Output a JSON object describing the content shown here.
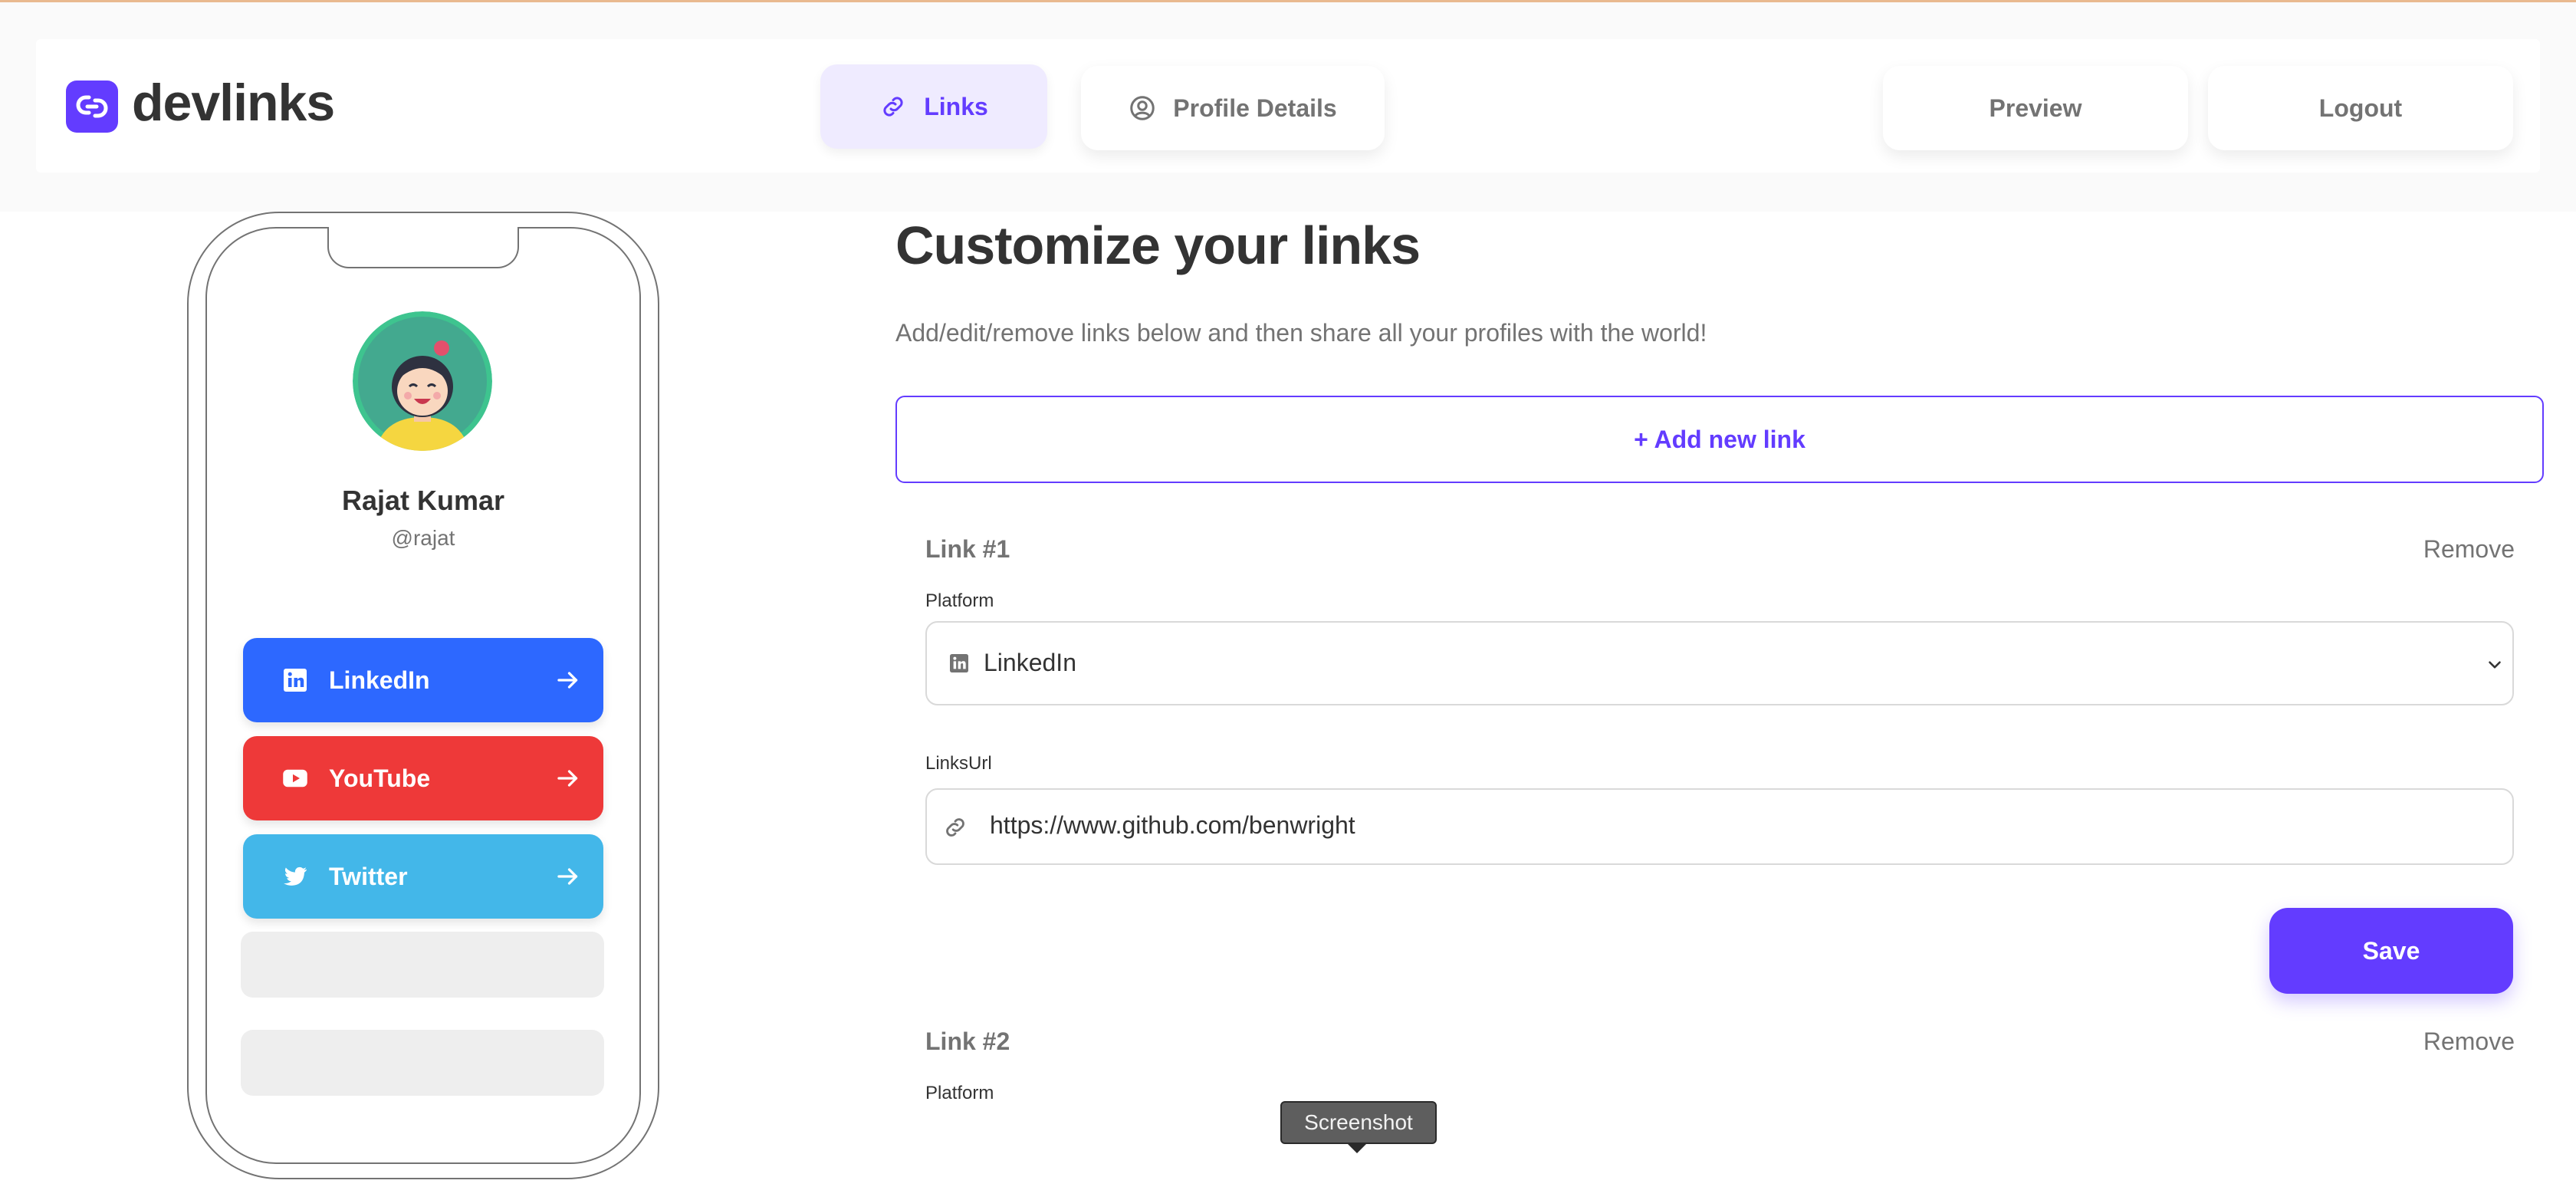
{
  "header": {
    "app_name": "devlinks",
    "tabs": [
      {
        "label": "Links",
        "icon": "link-icon",
        "active": true
      },
      {
        "label": "Profile Details",
        "icon": "user-circle-icon",
        "active": false
      }
    ],
    "preview_label": "Preview",
    "logout_label": "Logout"
  },
  "preview": {
    "name": "Rajat Kumar",
    "handle": "@rajat",
    "links": [
      {
        "label": "LinkedIn",
        "icon": "linkedin-icon",
        "color": "#2d68ff"
      },
      {
        "label": "YouTube",
        "icon": "youtube-icon",
        "color": "#ee3939"
      },
      {
        "label": "Twitter",
        "icon": "twitter-icon",
        "color": "#43b7e9"
      }
    ]
  },
  "main": {
    "title": "Customize your links",
    "subtitle": "Add/edit/remove links below and then share all your profiles with the world!",
    "add_link_label": "+ Add new link",
    "links": [
      {
        "heading": "Link #1",
        "remove_label": "Remove",
        "platform_label": "Platform",
        "platform_value": "LinkedIn",
        "url_label": "LinksUrl",
        "url_value": "https://www.github.com/benwright"
      },
      {
        "heading": "Link #2",
        "remove_label": "Remove",
        "platform_label": "Platform"
      }
    ],
    "save_label": "Save"
  },
  "tooltip": {
    "text": "Screenshot"
  },
  "colors": {
    "accent": "#633cff",
    "accent_light": "#efebff",
    "text_dark": "#333333",
    "text_gray": "#737373",
    "border": "#d9d9d9"
  }
}
